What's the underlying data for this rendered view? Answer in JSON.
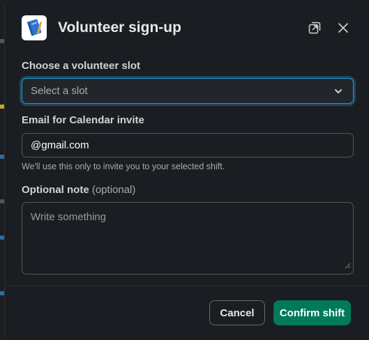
{
  "modal": {
    "title": "Volunteer sign-up",
    "app_icon": "notebook-icon",
    "open_in_window_icon": "popout-icon",
    "close_icon": "close-icon"
  },
  "slot": {
    "label": "Choose a volunteer slot",
    "placeholder": "Select a slot",
    "icon": "chevron-down-icon"
  },
  "email": {
    "label": "Email for Calendar invite",
    "value": "@gmail.com",
    "hint": "We'll use this only to invite you to your selected shift."
  },
  "note": {
    "label": "Optional note",
    "optional_suffix": "(optional)",
    "placeholder": "Write something"
  },
  "footer": {
    "cancel_label": "Cancel",
    "confirm_label": "Confirm shift"
  },
  "colors": {
    "background": "#1a1d21",
    "focus_ring": "#1d9bd1",
    "confirm": "#007a5a"
  }
}
